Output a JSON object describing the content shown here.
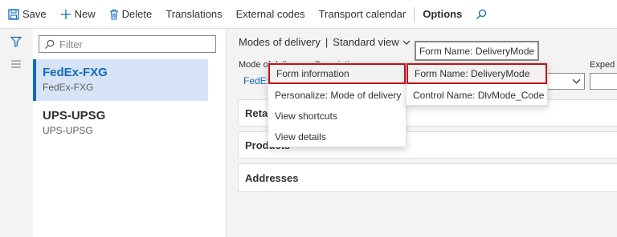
{
  "toolbar": {
    "save": "Save",
    "new": "New",
    "delete": "Delete",
    "translations": "Translations",
    "external_codes": "External codes",
    "transport_calendar": "Transport calendar",
    "options": "Options"
  },
  "filter": {
    "placeholder": "Filter"
  },
  "list": [
    {
      "title": "FedEx-FXG",
      "subtitle": "FedEx-FXG",
      "selected": true
    },
    {
      "title": "UPS-UPSG",
      "subtitle": "UPS-UPSG",
      "selected": false
    }
  ],
  "main": {
    "view_page": "Modes of delivery",
    "view_separator": "|",
    "view_name": "Standard view",
    "field_label_mode": "Mode of delivery",
    "field_label_desc": "Description",
    "field_value_mode": "FedEx",
    "field_label_expedite": "Exped",
    "sections": [
      "Retail",
      "Products",
      "Addresses"
    ]
  },
  "tooltip": "Form Name: DeliveryMode",
  "context_menu": {
    "items": [
      "Form information",
      "Personalize: Mode of delivery",
      "View shortcuts",
      "View details"
    ]
  },
  "submenu": {
    "items": [
      "Form Name: DeliveryMode",
      "Control Name: DlvMode_Code"
    ]
  },
  "colors": {
    "accent": "#0f6cbd",
    "highlight_border": "#c50f1f",
    "selected_bg": "#d7e3f7"
  }
}
